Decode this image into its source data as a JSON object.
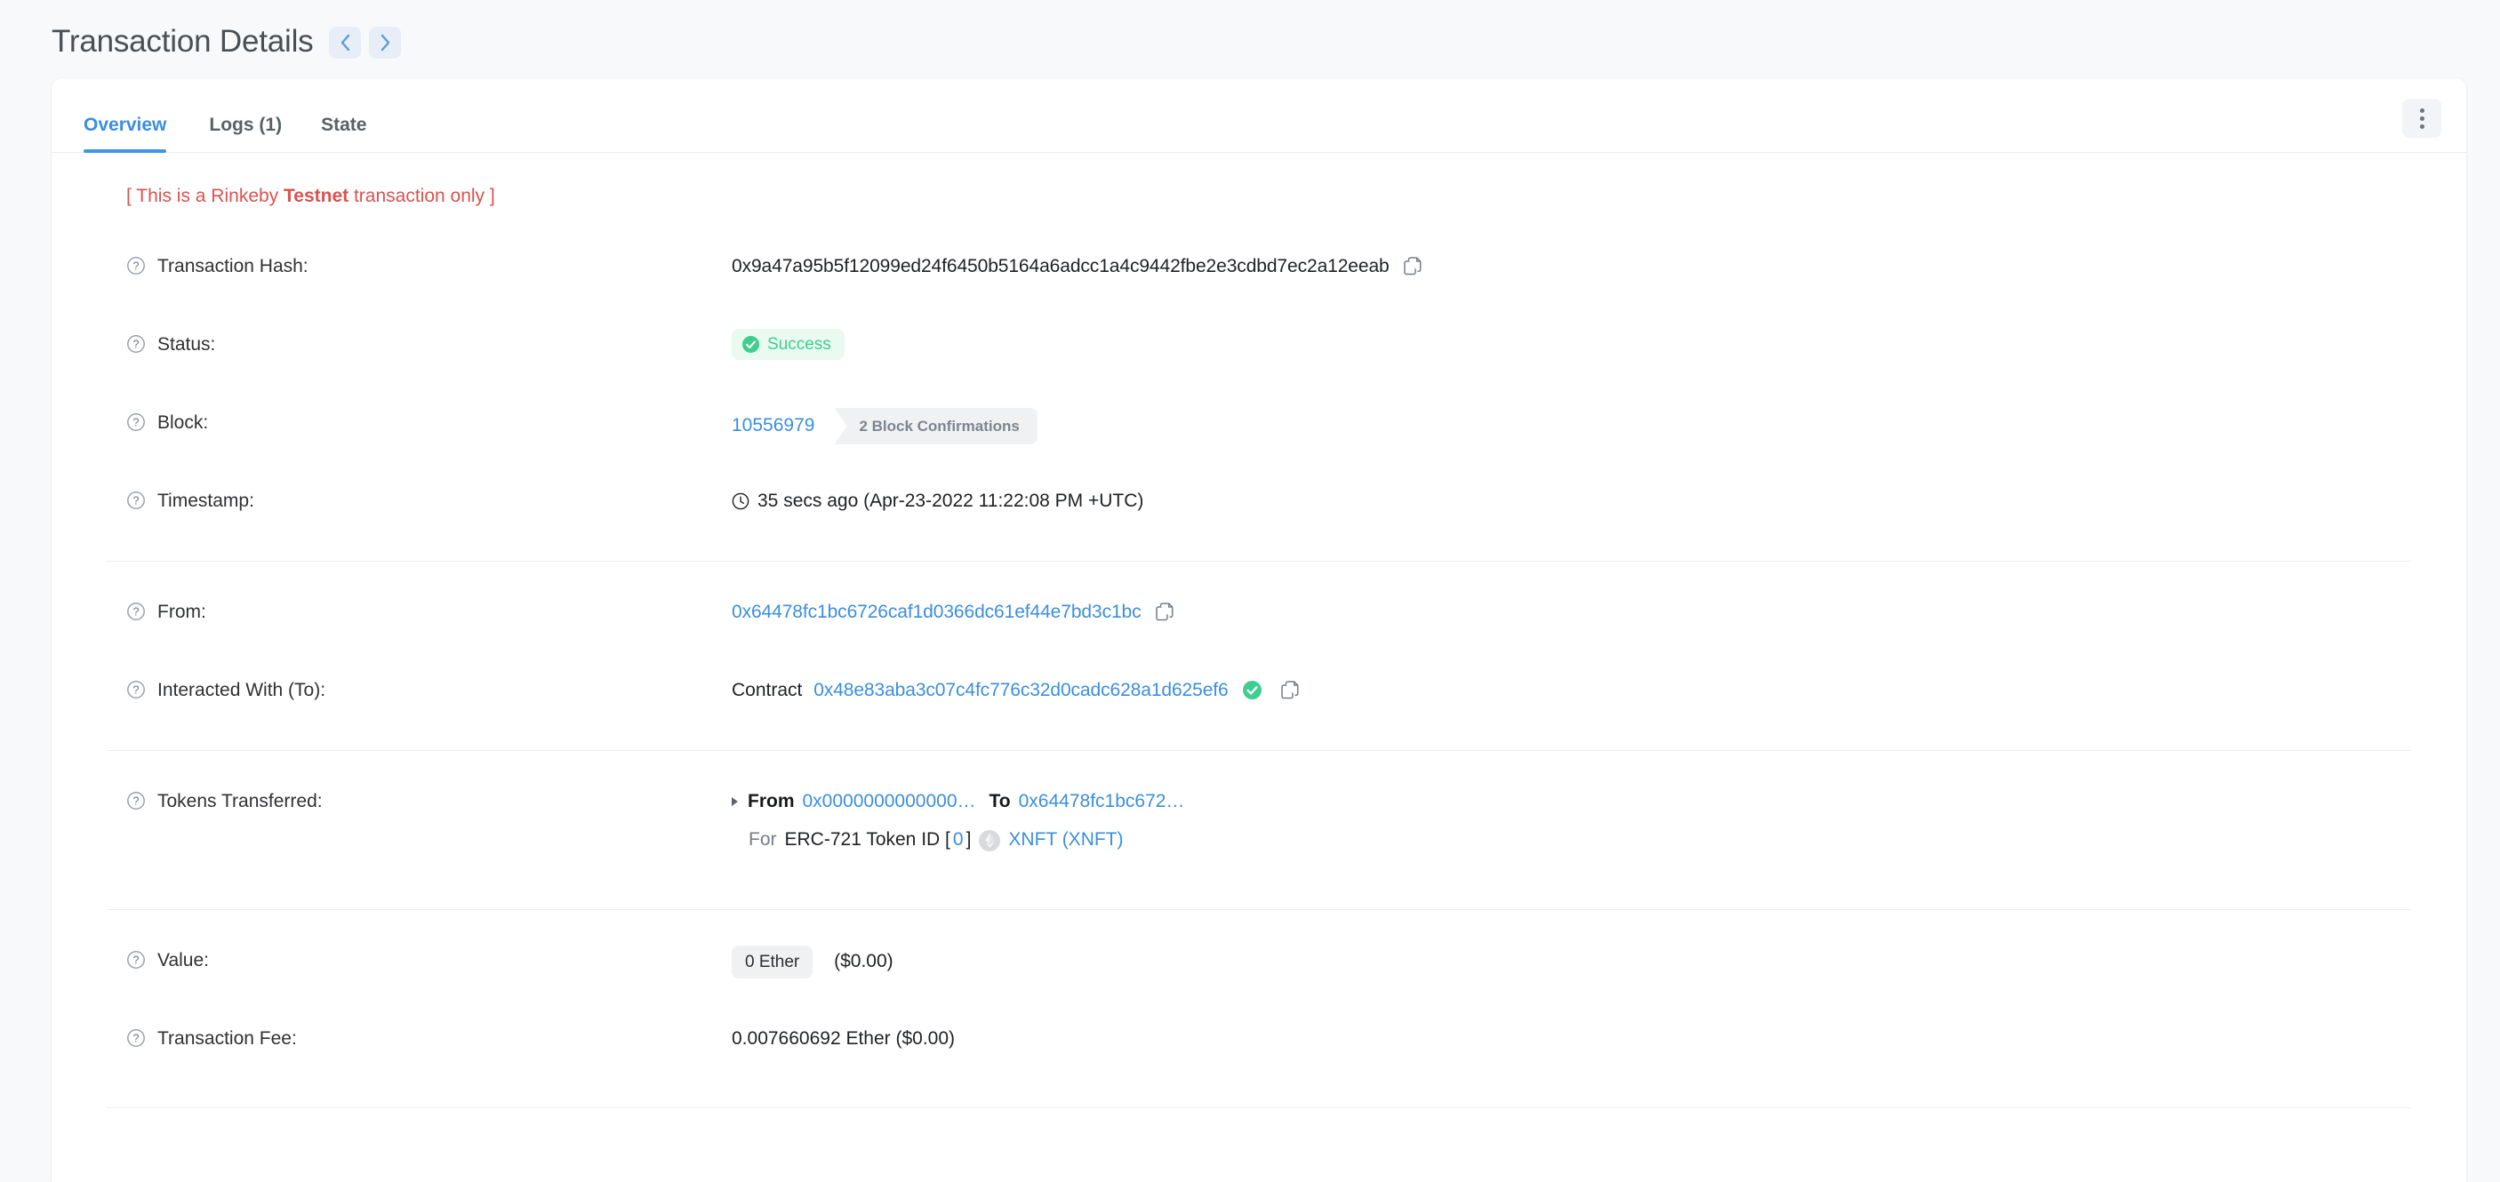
{
  "header": {
    "title": "Transaction Details",
    "prev_label": "‹",
    "next_label": "›"
  },
  "tabs": [
    {
      "label": "Overview",
      "active": true
    },
    {
      "label": "Logs (1)",
      "active": false
    },
    {
      "label": "State",
      "active": false
    }
  ],
  "banner": {
    "prefix": "[ This is a Rinkeby ",
    "emphasis": "Testnet",
    "suffix": " transaction only ]"
  },
  "fields": {
    "transaction_hash": {
      "label": "Transaction Hash:",
      "value": "0x9a47a95b5f12099ed24f6450b5164a6adcc1a4c9442fbe2e3cdbd7ec2a12eeab"
    },
    "status": {
      "label": "Status:",
      "value": "Success"
    },
    "block": {
      "label": "Block:",
      "number": "10556979",
      "confirmations": "2 Block Confirmations"
    },
    "timestamp": {
      "label": "Timestamp:",
      "value": "35 secs ago (Apr-23-2022 11:22:08 PM +UTC)"
    },
    "from": {
      "label": "From:",
      "value": "0x64478fc1bc6726caf1d0366dc61ef44e7bd3c1bc"
    },
    "interacted_with": {
      "label": "Interacted With (To):",
      "prefix": "Contract",
      "value": "0x48e83aba3c07c4fc776c32d0cadc628a1d625ef6"
    },
    "tokens_transferred": {
      "label": "Tokens Transferred:",
      "from_word": "From",
      "from_addr": "0x0000000000000…",
      "to_word": "To",
      "to_addr": "0x64478fc1bc672…",
      "for_word": "For",
      "token_standard": "ERC-721 Token ID [",
      "token_id": "0",
      "token_id_close": "]",
      "token_name": "XNFT (XNFT)"
    },
    "value": {
      "label": "Value:",
      "amount": "0 Ether",
      "usd": "($0.00)"
    },
    "transaction_fee": {
      "label": "Transaction Fee:",
      "value": "0.007660692 Ether ($0.00)"
    }
  },
  "colors": {
    "link": "#3b8ede",
    "success": "#3ecf8e",
    "danger": "#d9534f",
    "page_bg": "#f8f9fa"
  }
}
